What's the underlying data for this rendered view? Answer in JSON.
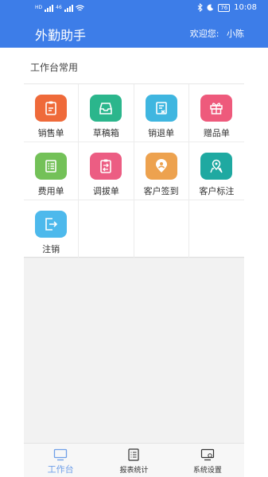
{
  "status_bar": {
    "time": "10:08",
    "battery": "76",
    "network_tag_1": "HD",
    "network_tag_2": "46"
  },
  "header": {
    "title": "外勤助手",
    "welcome_label": "欢迎您:",
    "user_name": "小陈"
  },
  "section": {
    "title": "工作台常用"
  },
  "colors": {
    "primary": "#3d7de8",
    "nav_active": "#6f9fe8"
  },
  "apps": [
    {
      "label": "销售单",
      "color": "#ef6a3a",
      "icon": "clipboard-edit-icon"
    },
    {
      "label": "草稿箱",
      "color": "#2bb68c",
      "icon": "inbox-tray-icon"
    },
    {
      "label": "销退单",
      "color": "#3fb6e0",
      "icon": "return-document-icon"
    },
    {
      "label": "赠品单",
      "color": "#ee5a7c",
      "icon": "gift-icon"
    },
    {
      "label": "费用单",
      "color": "#73c158",
      "icon": "expense-list-icon"
    },
    {
      "label": "调拔单",
      "color": "#ec5d83",
      "icon": "transfer-clipboard-icon"
    },
    {
      "label": "客户签到",
      "color": "#eda24f",
      "icon": "location-person-icon"
    },
    {
      "label": "客户标注",
      "color": "#1fa9a1",
      "icon": "map-pin-icon"
    },
    {
      "label": "注销",
      "color": "#4db9ec",
      "icon": "logout-icon"
    }
  ],
  "bottom_nav": [
    {
      "label": "工作台",
      "icon": "desktop-icon",
      "active": true
    },
    {
      "label": "报表统计",
      "icon": "report-list-icon",
      "active": false
    },
    {
      "label": "系统设置",
      "icon": "settings-monitor-icon",
      "active": false
    }
  ]
}
